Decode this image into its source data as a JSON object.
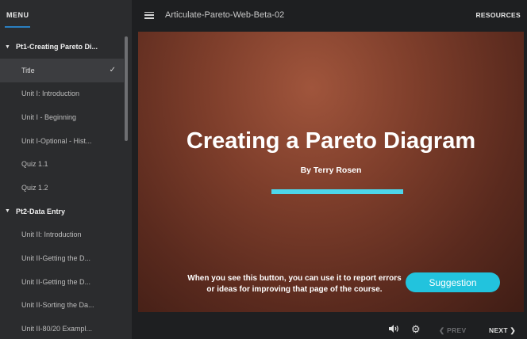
{
  "sidebar": {
    "header": "MENU",
    "sections": [
      {
        "label": "Pt1-Creating Pareto Di...",
        "items": [
          {
            "label": "Title",
            "active": true
          },
          {
            "label": "Unit I: Introduction"
          },
          {
            "label": "Unit I - Beginning"
          },
          {
            "label": "Unit I-Optional - Hist..."
          },
          {
            "label": "Quiz 1.1"
          },
          {
            "label": "Quiz 1.2"
          }
        ]
      },
      {
        "label": "Pt2-Data Entry",
        "items": [
          {
            "label": "Unit II: Introduction"
          },
          {
            "label": "Unit II-Getting the D..."
          },
          {
            "label": "Unit II-Getting the D..."
          },
          {
            "label": "Unit II-Sorting the Da..."
          },
          {
            "label": "Unit II-80/20 Exampl..."
          }
        ]
      }
    ]
  },
  "topbar": {
    "course_title": "Articulate-Pareto-Web-Beta-02",
    "resources_label": "RESOURCES"
  },
  "slide": {
    "title": "Creating a Pareto Diagram",
    "author": "By Terry Rosen",
    "note": "When you see this button, you can use it to report errors or ideas for improving that page of the course.",
    "suggestion_label": "Suggestion"
  },
  "controls": {
    "prev_label": "PREV",
    "next_label": "NEXT"
  },
  "icons": {
    "hamburger": "menu-icon",
    "check": "check-icon",
    "volume": "volume-icon",
    "settings": "gear-icon",
    "prev": "chevron-left-icon",
    "next": "chevron-right-icon"
  },
  "colors": {
    "accent": "#2a7fc0",
    "suggestion": "#22c3dd",
    "title_bar": "#4dd6ea"
  }
}
